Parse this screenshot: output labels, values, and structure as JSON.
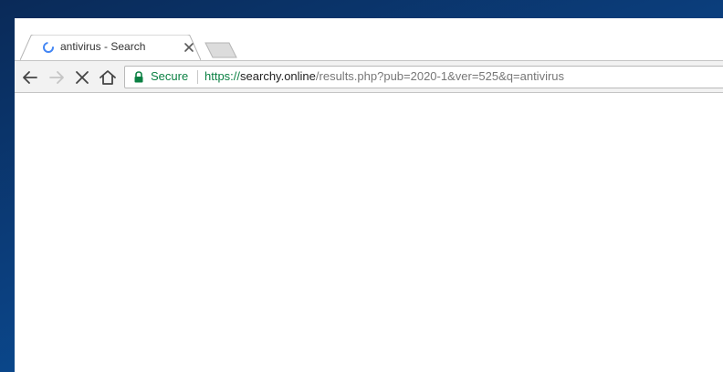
{
  "browser": {
    "tab": {
      "title": "antivirus - Search",
      "favicon": "loading-spinner-icon",
      "close_icon": "close-icon"
    },
    "new_tab_icon": "new-tab-icon",
    "toolbar": {
      "back_icon": "back-arrow-icon",
      "forward_icon": "forward-arrow-icon",
      "stop_icon": "stop-loading-icon",
      "home_icon": "home-icon"
    },
    "omnibox": {
      "security_label": "Secure",
      "url_scheme": "https://",
      "url_host": "searchy.online",
      "url_rest": "/results.php?pub=2020-1&ver=525&q=antivirus"
    }
  },
  "colors": {
    "secure_green": "#0b8043",
    "spinner_blue": "#4285f4",
    "desktop_blue": "#0b3f7e"
  }
}
